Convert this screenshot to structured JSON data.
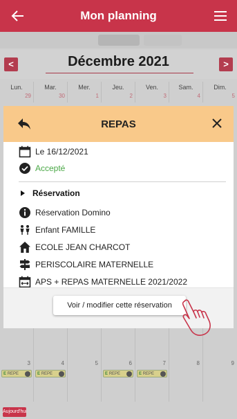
{
  "header": {
    "title": "Mon planning"
  },
  "calendar": {
    "month": "Décembre 2021",
    "prev_label": "<",
    "next_label": ">",
    "weekdays": [
      {
        "label": "Lun.",
        "date": "29"
      },
      {
        "label": "Mar.",
        "date": "30"
      },
      {
        "label": "Mer.",
        "date": "1"
      },
      {
        "label": "Jeu.",
        "date": "2"
      },
      {
        "label": "Ven.",
        "date": "3"
      },
      {
        "label": "Sam.",
        "date": "4"
      },
      {
        "label": "Dim.",
        "date": "5"
      }
    ],
    "week2": [
      "3",
      "4",
      "5",
      "6",
      "7",
      "8",
      "9"
    ],
    "chip_letter": "E",
    "chip_label": "REPE",
    "today_label": "Aujourd'hui"
  },
  "detail": {
    "title": "REPAS",
    "date": "Le 16/12/2021",
    "status": "Accepté",
    "reservation_title": "Réservation",
    "items": [
      "Réservation Domino",
      "Enfant FAMILLE",
      "ECOLE JEAN CHARCOT",
      "PERISCOLAIRE MATERNELLE",
      "APS + REPAS MATERNELLE 2021/2022"
    ],
    "action": "Voir / modifier cette réservation"
  },
  "colors": {
    "brand": "#c8344a",
    "header_band": "#f9c98a",
    "accepted": "#4aa846"
  }
}
